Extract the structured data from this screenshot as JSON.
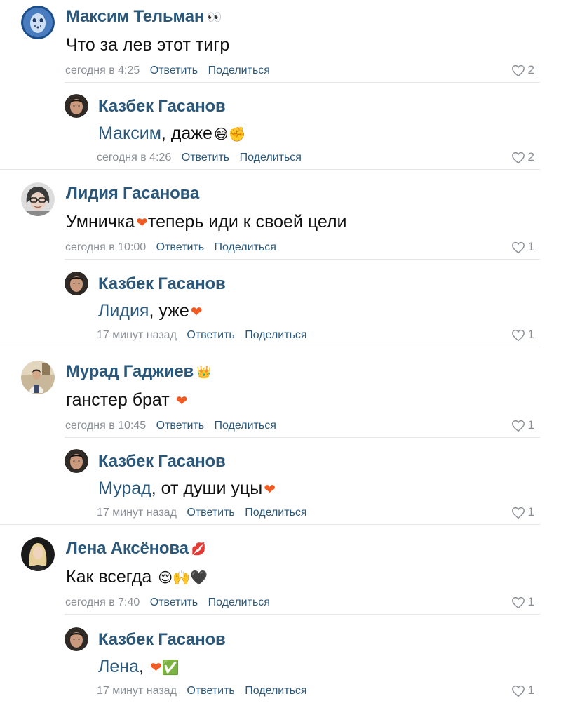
{
  "comments": [
    {
      "author": "Максим Тельман",
      "badge": "👀",
      "text_parts": [
        {
          "type": "text",
          "value": "Что за лев этот тигр"
        }
      ],
      "time": "сегодня в 4:25",
      "reply": "Ответить",
      "share": "Поделиться",
      "likes": "2",
      "avatar": "avatar-hockey-mask"
    },
    {
      "author": "Казбек Гасанов",
      "badge": "",
      "text_parts": [
        {
          "type": "mention",
          "value": "Максим"
        },
        {
          "type": "text",
          "value": ", даже"
        },
        {
          "type": "emoji",
          "value": "😅✊"
        }
      ],
      "time": "сегодня в 4:26",
      "reply": "Ответить",
      "share": "Поделиться",
      "likes": "2",
      "avatar": "avatar-man"
    },
    {
      "author": "Лидия Гасанова",
      "badge": "",
      "text_parts": [
        {
          "type": "text",
          "value": "Умничка"
        },
        {
          "type": "emoji",
          "value": "❤"
        },
        {
          "type": "text",
          "value": "теперь иди к своей цели"
        }
      ],
      "time": "сегодня в 10:00",
      "reply": "Ответить",
      "share": "Поделиться",
      "likes": "1",
      "avatar": "avatar-woman-glasses"
    },
    {
      "author": "Казбек Гасанов",
      "badge": "",
      "text_parts": [
        {
          "type": "mention",
          "value": "Лидия"
        },
        {
          "type": "text",
          "value": ", уже"
        },
        {
          "type": "emoji",
          "value": "❤"
        }
      ],
      "time": "17 минут назад",
      "reply": "Ответить",
      "share": "Поделиться",
      "likes": "1",
      "avatar": "avatar-man"
    },
    {
      "author": "Мурад Гаджиев",
      "badge": "👑",
      "text_parts": [
        {
          "type": "text",
          "value": "ганстер брат "
        },
        {
          "type": "emoji",
          "value": "❤"
        }
      ],
      "time": "сегодня в 10:45",
      "reply": "Ответить",
      "share": "Поделиться",
      "likes": "1",
      "avatar": "avatar-man-room"
    },
    {
      "author": "Казбек Гасанов",
      "badge": "",
      "text_parts": [
        {
          "type": "mention",
          "value": "Мурад"
        },
        {
          "type": "text",
          "value": ", от души уцы"
        },
        {
          "type": "emoji",
          "value": "❤"
        }
      ],
      "time": "17 минут назад",
      "reply": "Ответить",
      "share": "Поделиться",
      "likes": "1",
      "avatar": "avatar-man"
    },
    {
      "author": "Лена Аксёнова",
      "badge": "💋",
      "text_parts": [
        {
          "type": "text",
          "value": "Как всегда "
        },
        {
          "type": "emoji",
          "value": "😌🙌🖤"
        }
      ],
      "time": "сегодня в 7:40",
      "reply": "Ответить",
      "share": "Поделиться",
      "likes": "1",
      "avatar": "avatar-woman-blonde"
    },
    {
      "author": "Казбек Гасанов",
      "badge": "",
      "text_parts": [
        {
          "type": "mention",
          "value": "Лена"
        },
        {
          "type": "text",
          "value": ", "
        },
        {
          "type": "emoji",
          "value": "❤✅"
        }
      ],
      "time": "17 минут назад",
      "reply": "Ответить",
      "share": "Поделиться",
      "likes": "1",
      "avatar": "avatar-man"
    }
  ],
  "colors": {
    "link": "#2b587a",
    "meta": "#8a8f96",
    "divider": "#e5e7ea",
    "heart": "#f15a22"
  }
}
